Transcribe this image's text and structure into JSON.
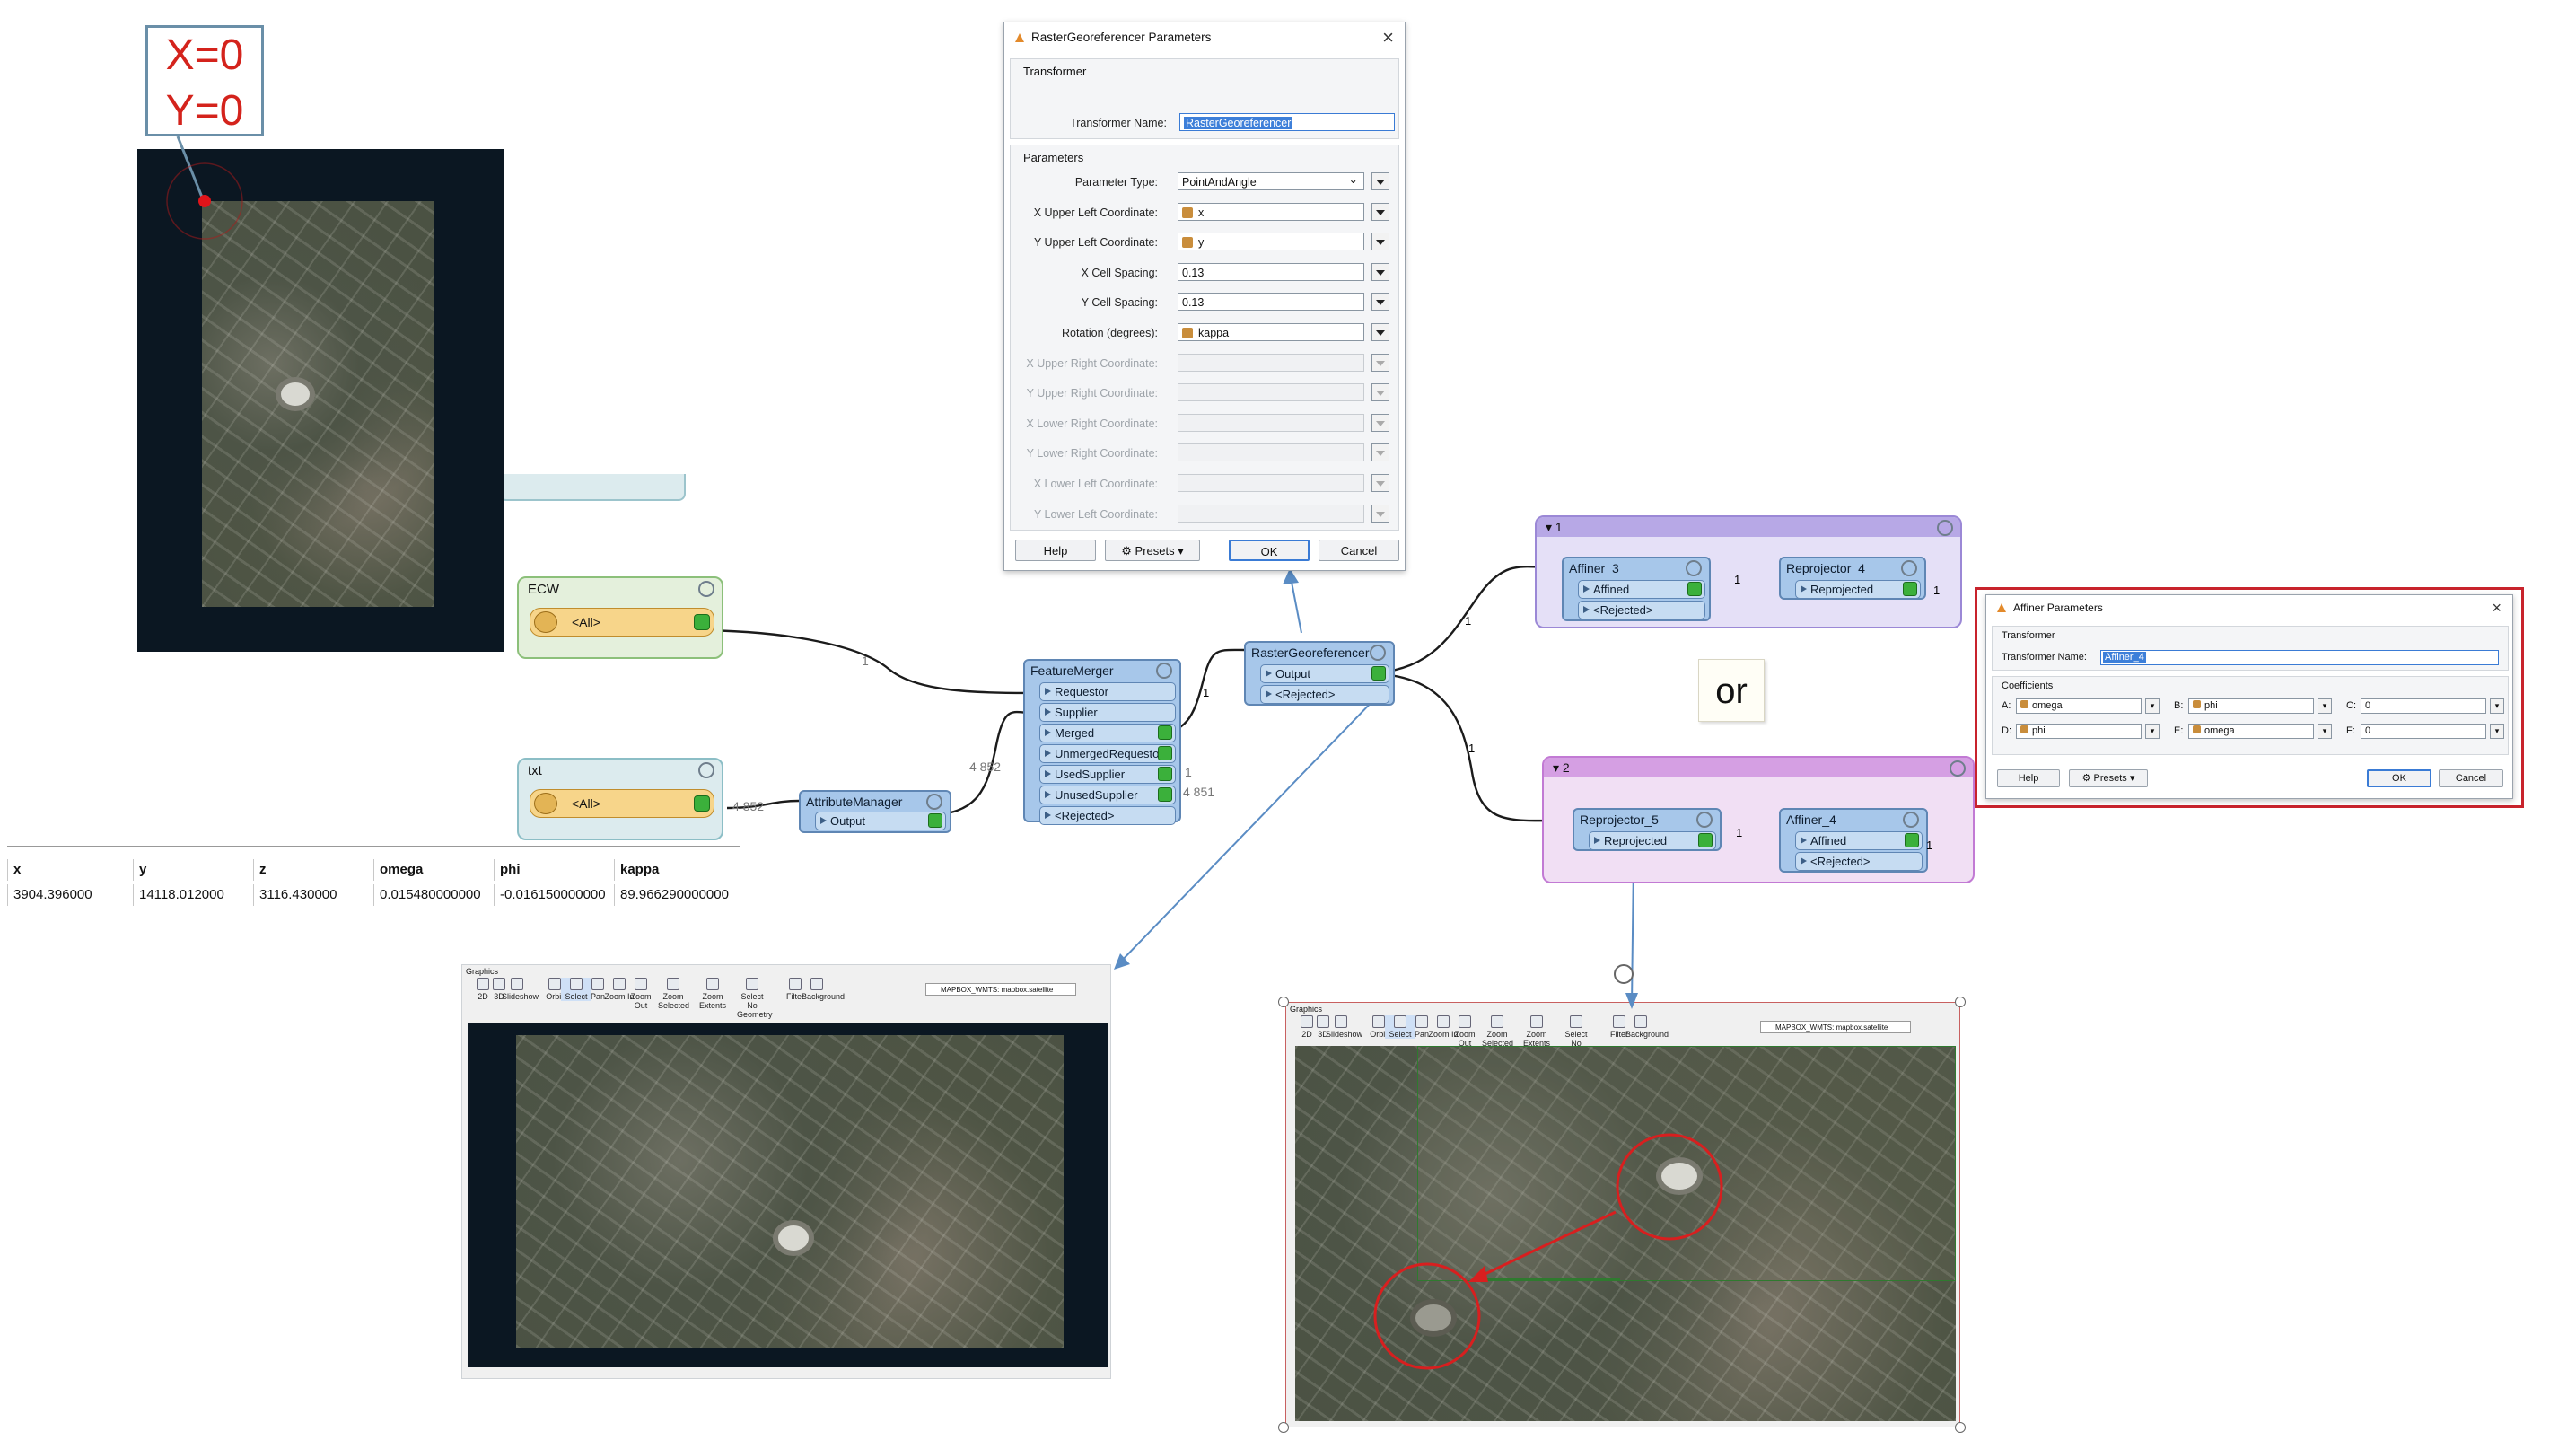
{
  "annotation": {
    "x_label": "X=0",
    "y_label": "Y=0"
  },
  "canvas": {
    "ecw_bookmark": {
      "title": "ECW",
      "port": "<All>"
    },
    "txt_bookmark": {
      "title": "txt",
      "port": "<All>"
    },
    "attribute_manager": {
      "name": "AttributeManager",
      "output": "Output"
    },
    "feature_merger": {
      "name": "FeatureMerger",
      "ports": [
        "Requestor",
        "Supplier",
        "Merged",
        "UnmergedRequestor",
        "UsedSupplier",
        "UnusedSupplier",
        "<Rejected>"
      ]
    },
    "raster_georeferencer": {
      "name": "RasterGeoreferencer",
      "output": "Output",
      "rejected": "<Rejected>"
    },
    "group1": {
      "title": "1",
      "affiner": {
        "name": "Affiner_3",
        "ports": [
          "Affined",
          "<Rejected>"
        ]
      },
      "reprojector": {
        "name": "Reprojector_4",
        "ports": [
          "Reprojected"
        ]
      }
    },
    "group2": {
      "title": "2",
      "reprojector": {
        "name": "Reprojector_5",
        "ports": [
          "Reprojected"
        ]
      },
      "affiner": {
        "name": "Affiner_4",
        "ports": [
          "Affined",
          "<Rejected>"
        ]
      }
    },
    "connection_labels": {
      "ecw_to_fm": "1",
      "txt_to_am": "4 852",
      "am_to_fm": "4 852",
      "fm_to_rg": "1",
      "used_supplier": "1",
      "unused_supplier": "4 851",
      "rg_to_g1": "1",
      "rg_to_g2": "1",
      "g1_mid": "1",
      "g1_out": "1",
      "g2_mid": "1",
      "g2_out": "1"
    },
    "or_note": "or"
  },
  "rg_dialog": {
    "title": "RasterGeoreferencer Parameters",
    "transformer_section": "Transformer",
    "transformer_name_label": "Transformer Name:",
    "transformer_name_value": "RasterGeoreferencer",
    "parameters_section": "Parameters",
    "rows": [
      {
        "label": "Parameter Type:",
        "value": "PointAndAngle",
        "attr": false,
        "enabled": true
      },
      {
        "label": "X Upper Left Coordinate:",
        "value": "x",
        "attr": true,
        "enabled": true
      },
      {
        "label": "Y Upper Left Coordinate:",
        "value": "y",
        "attr": true,
        "enabled": true
      },
      {
        "label": "X Cell Spacing:",
        "value": "0.13",
        "attr": false,
        "enabled": true
      },
      {
        "label": "Y Cell Spacing:",
        "value": "0.13",
        "attr": false,
        "enabled": true
      },
      {
        "label": "Rotation (degrees):",
        "value": "kappa",
        "attr": true,
        "enabled": true
      },
      {
        "label": "X Upper Right Coordinate:",
        "value": "",
        "attr": false,
        "enabled": false
      },
      {
        "label": "Y Upper Right Coordinate:",
        "value": "",
        "attr": false,
        "enabled": false
      },
      {
        "label": "X Lower Right Coordinate:",
        "value": "",
        "attr": false,
        "enabled": false
      },
      {
        "label": "Y Lower Right Coordinate:",
        "value": "",
        "attr": false,
        "enabled": false
      },
      {
        "label": "X Lower Left Coordinate:",
        "value": "",
        "attr": false,
        "enabled": false
      },
      {
        "label": "Y Lower Left Coordinate:",
        "value": "",
        "attr": false,
        "enabled": false
      }
    ],
    "buttons": {
      "help": "Help",
      "presets": "Presets",
      "ok": "OK",
      "cancel": "Cancel"
    }
  },
  "affiner_dialog": {
    "title": "Affiner Parameters",
    "transformer_section": "Transformer",
    "transformer_name_label": "Transformer Name:",
    "transformer_name_value": "Affiner_4",
    "coefficients_section": "Coefficients",
    "coefficients": [
      {
        "label": "A:",
        "value": "omega"
      },
      {
        "label": "B:",
        "value": "phi"
      },
      {
        "label": "C:",
        "value": "0"
      },
      {
        "label": "D:",
        "value": "phi"
      },
      {
        "label": "E:",
        "value": "omega"
      },
      {
        "label": "F:",
        "value": "0"
      }
    ],
    "buttons": {
      "help": "Help",
      "presets": "Presets",
      "ok": "OK",
      "cancel": "Cancel"
    }
  },
  "data_table": {
    "headers": [
      "x",
      "y",
      "z",
      "omega",
      "phi",
      "kappa"
    ],
    "row": [
      "3904.396000",
      "14118.012000",
      "3116.430000",
      "0.015480000000",
      "-0.016150000000",
      "89.966290000000"
    ]
  },
  "graphics_left": {
    "title": "Graphics",
    "tools": [
      "2D",
      "3D",
      "Slideshow",
      "Orbit",
      "Select",
      "Pan",
      "Zoom In",
      "Zoom Out",
      "Zoom Selected",
      "Zoom Extents",
      "Select No Geometry",
      "Filter",
      "Background"
    ],
    "background_select": "MAPBOX_WMTS: mapbox.satellite"
  },
  "graphics_right": {
    "title": "Graphics",
    "tools": [
      "2D",
      "3D",
      "Slideshow",
      "Orbit",
      "Select",
      "Pan",
      "Zoom In",
      "Zoom Out",
      "Zoom Selected",
      "Zoom Extents",
      "Select No Geometry",
      "Filter",
      "Background"
    ],
    "background_select": "MAPBOX_WMTS: mapbox.satellite"
  },
  "colors": {
    "annotation_red": "#d4231c",
    "group1_fill": "#e5e0f7",
    "group2_fill": "#f1dff4",
    "ecw_fill": "#e4f0dc",
    "txt_fill": "#dcebee",
    "transformer": "#a7c7ea",
    "frame_red": "#c8232c"
  }
}
